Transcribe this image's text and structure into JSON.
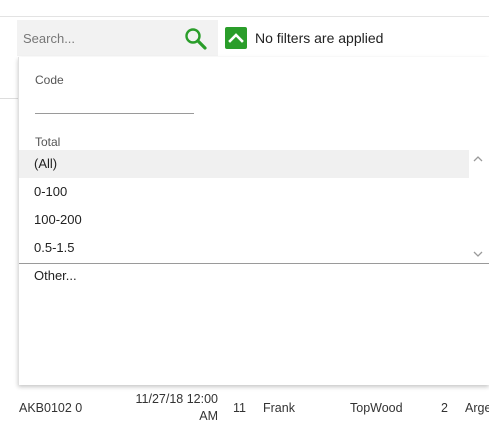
{
  "toolbar": {
    "search_placeholder": "Search...",
    "filter_status": "No filters are applied",
    "accent_color": "#2a9d2a"
  },
  "filter_panel": {
    "code_label": "Code",
    "code_value": "",
    "total_label": "Total",
    "total_options": [
      "(All)",
      "0-100",
      "100-200",
      "0.5-1.5"
    ],
    "selected_option": "(All)",
    "other_label": "Other..."
  },
  "table": {
    "rows": [
      {
        "code": "AKB0102 0",
        "date": "11/27/18 12:00 AM",
        "count": "11",
        "name": "Frank",
        "company": "TopWood",
        "qty": "2",
        "country": "Arge"
      }
    ]
  }
}
